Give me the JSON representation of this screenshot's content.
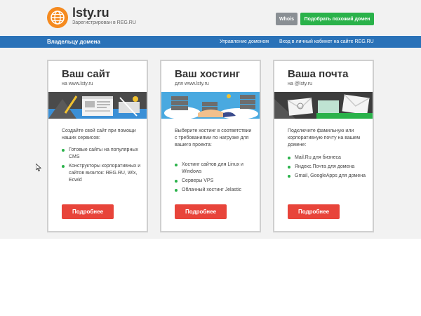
{
  "header": {
    "site_name": "lsty.ru",
    "registered_text": "Зарегистрирован в REG.RU",
    "whois_label": "Whois",
    "similar_label": "Подобрать похожий домен",
    "logo_icon": "globe-icon",
    "brand_color": "#f58a1f"
  },
  "nav": {
    "title": "Владельцу домена",
    "links": [
      "Управление доменом",
      "Вход в личный кабинет на сайте REG.RU"
    ]
  },
  "cards": [
    {
      "title": "Ваш сайт",
      "subtitle": "на www.lsty.ru",
      "text": "Создайте свой сайт при помощи наших сервисов:",
      "items": [
        "Готовые сайты на популярных CMS",
        "Конструкторы корпоративных и сайтов визиток: REG.RU, Wix, Ecwid"
      ],
      "button": "Подробнее"
    },
    {
      "title": "Ваш хостинг",
      "subtitle": "для www.lsty.ru",
      "text": "Выберите хостинг в соответствии с требованиями по нагрузке для вашего проекта:",
      "items": [
        "Хостинг сайтов для Linux и Windows",
        "Серверы VPS",
        "Облачный хостинг Jelastic"
      ],
      "button": "Подробнее"
    },
    {
      "title": "Ваша почта",
      "subtitle": "на @lsty.ru",
      "text": "Подключите фамильную или корпоративную почту на вашем домене:",
      "items": [
        "Mail.Ru для бизнеса",
        "Яндекс.Почта для домена",
        "Gmail, GoogleApps для домена"
      ],
      "button": "Подробнее"
    }
  ],
  "colors": {
    "nav_bg": "#2a72b8",
    "accent_green": "#2ab24a",
    "button_red": "#e8443a",
    "whois_gray": "#8a8f94"
  }
}
